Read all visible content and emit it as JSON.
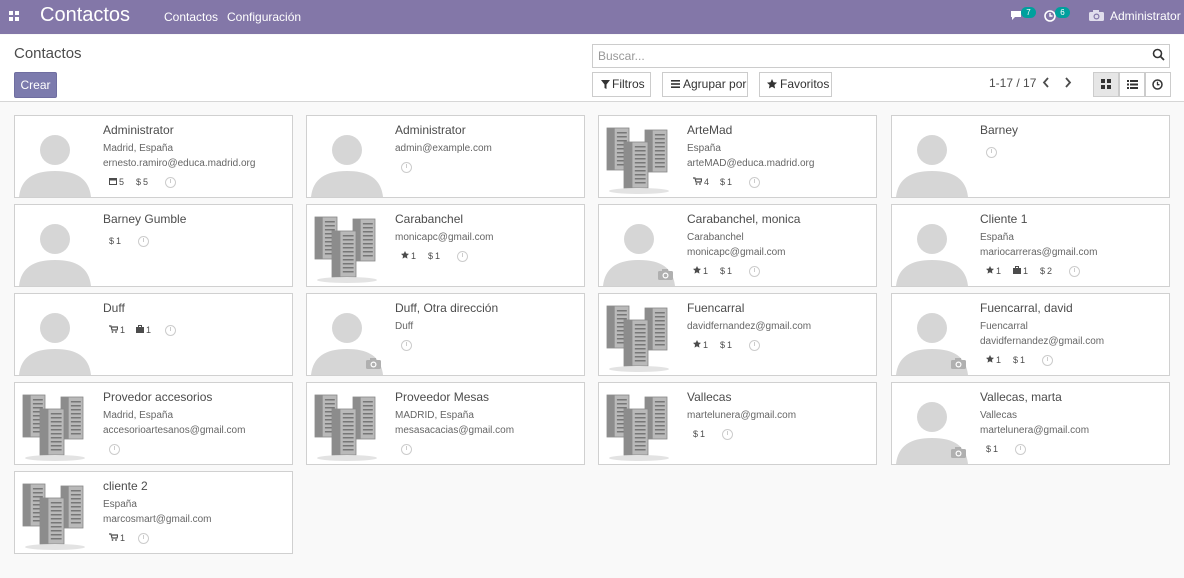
{
  "topbar": {
    "app_name": "Contactos",
    "menu": [
      {
        "label": "Contactos"
      },
      {
        "label": "Configuración"
      }
    ],
    "messages_count": "7",
    "activities_count": "6",
    "user": "Administrator",
    "color": "#8377a8"
  },
  "control_panel": {
    "breadcrumb": "Contactos",
    "create_label": "Crear",
    "search_placeholder": "Buscar...",
    "filters_label": "Filtros",
    "group_by_label": "Agrupar por",
    "favorites_label": "Favoritos",
    "pager": "1-17 / 17"
  },
  "cards": [
    {
      "name": "Administrator",
      "line1": "Madrid, España",
      "line2": "ernesto.ramiro@educa.madrid.org",
      "avatar": "person",
      "tags": [
        {
          "icon": "calendar-icon",
          "text": "5"
        },
        {
          "icon": "dollar-icon",
          "text": "5"
        }
      ]
    },
    {
      "name": "Administrator",
      "line1": "admin@example.com",
      "line2": "",
      "avatar": "person",
      "tags": []
    },
    {
      "name": "ArteMad",
      "line1": "España",
      "line2": "arteMAD@educa.madrid.org",
      "avatar": "company",
      "tags": [
        {
          "icon": "cart-icon",
          "text": "4"
        },
        {
          "icon": "dollar-icon",
          "text": "1"
        }
      ]
    },
    {
      "name": "Barney",
      "line1": "",
      "line2": "",
      "avatar": "person",
      "tags": []
    },
    {
      "name": "Barney Gumble",
      "line1": "",
      "line2": "",
      "avatar": "person",
      "tags": [
        {
          "icon": "dollar-icon",
          "text": "1"
        }
      ]
    },
    {
      "name": "Carabanchel",
      "line1": "monicapc@gmail.com",
      "line2": "",
      "avatar": "company",
      "tags": [
        {
          "icon": "star-icon",
          "text": "1"
        },
        {
          "icon": "dollar-icon",
          "text": "1"
        }
      ]
    },
    {
      "name": "Carabanchel, monica",
      "line1": "Carabanchel",
      "line2": "monicapc@gmail.com",
      "avatar": "person-camera",
      "tags": [
        {
          "icon": "star-icon",
          "text": "1"
        },
        {
          "icon": "dollar-icon",
          "text": "1"
        }
      ]
    },
    {
      "name": "Cliente 1",
      "line1": "España",
      "line2": "mariocarreras@gmail.com",
      "avatar": "person",
      "tags": [
        {
          "icon": "star-icon",
          "text": "1"
        },
        {
          "icon": "briefcase-icon",
          "text": "1"
        },
        {
          "icon": "dollar-icon",
          "text": "2"
        }
      ]
    },
    {
      "name": "Duff",
      "line1": "",
      "line2": "",
      "avatar": "person",
      "tags": [
        {
          "icon": "cart-icon",
          "text": "1"
        },
        {
          "icon": "briefcase-icon",
          "text": "1"
        }
      ]
    },
    {
      "name": "Duff, Otra dirección",
      "line1": "Duff",
      "line2": "",
      "avatar": "person-camera",
      "tags": []
    },
    {
      "name": "Fuencarral",
      "line1": "davidfernandez@gmail.com",
      "line2": "",
      "avatar": "company",
      "tags": [
        {
          "icon": "star-icon",
          "text": "1"
        },
        {
          "icon": "dollar-icon",
          "text": "1"
        }
      ]
    },
    {
      "name": "Fuencarral, david",
      "line1": "Fuencarral",
      "line2": "davidfernandez@gmail.com",
      "avatar": "person-camera",
      "tags": [
        {
          "icon": "star-icon",
          "text": "1"
        },
        {
          "icon": "dollar-icon",
          "text": "1"
        }
      ]
    },
    {
      "name": "Provedor accesorios",
      "line1": "Madrid, España",
      "line2": "accesorioartesanos@gmail.com",
      "avatar": "company",
      "tags": []
    },
    {
      "name": "Proveedor Mesas",
      "line1": "MADRID, España",
      "line2": "mesasacacias@gmail.com",
      "avatar": "company",
      "tags": []
    },
    {
      "name": "Vallecas",
      "line1": "martelunera@gmail.com",
      "line2": "",
      "avatar": "company",
      "tags": [
        {
          "icon": "dollar-icon",
          "text": "1"
        }
      ]
    },
    {
      "name": "Vallecas, marta",
      "line1": "Vallecas",
      "line2": "martelunera@gmail.com",
      "avatar": "person-camera",
      "tags": [
        {
          "icon": "dollar-icon",
          "text": "1"
        }
      ]
    },
    {
      "name": "cliente 2",
      "line1": "España",
      "line2": "marcosmart@gmail.com",
      "avatar": "company",
      "tags": [
        {
          "icon": "cart-icon",
          "text": "1"
        }
      ]
    }
  ]
}
